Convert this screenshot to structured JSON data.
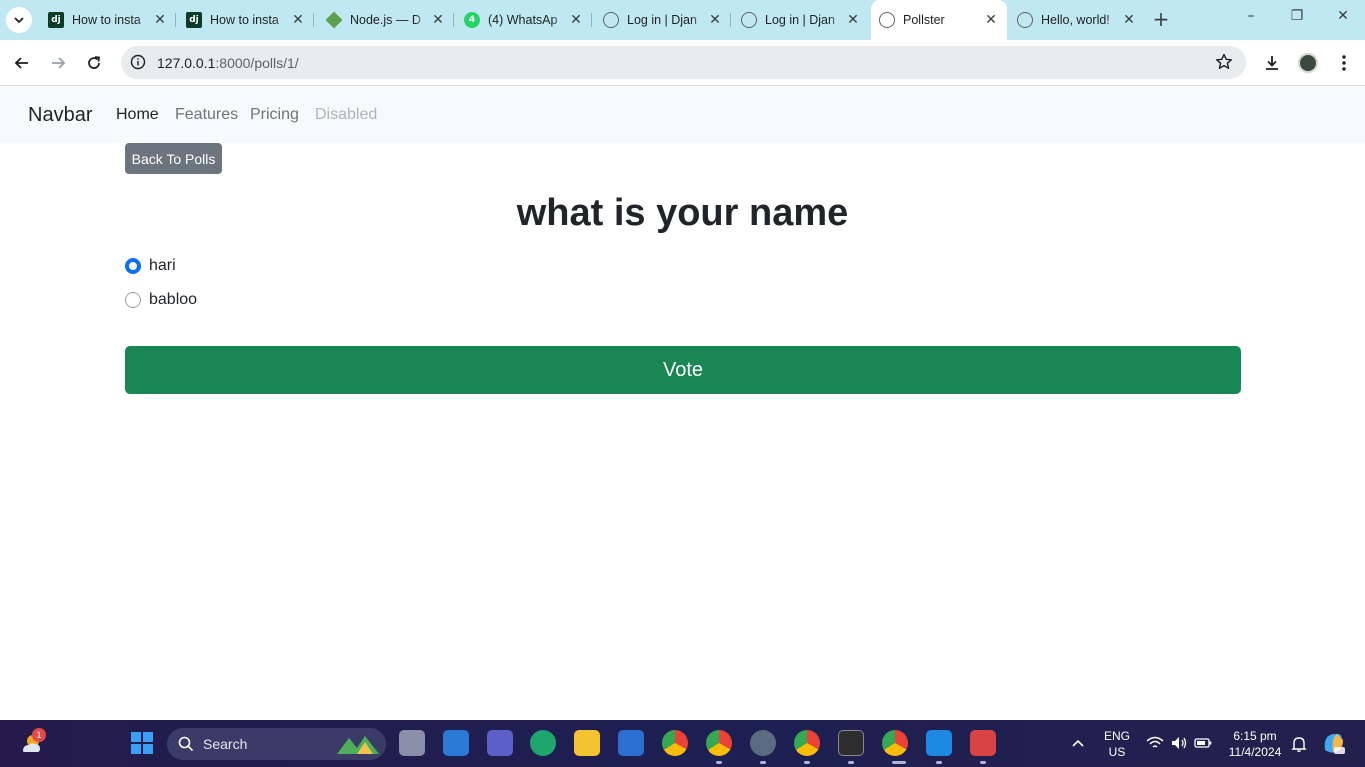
{
  "browser": {
    "tabs": [
      {
        "title": "How to insta",
        "favicon": "dj"
      },
      {
        "title": "How to insta",
        "favicon": "dj"
      },
      {
        "title": "Node.js — D",
        "favicon": "node"
      },
      {
        "title": "(4) WhatsAp",
        "favicon": "whatsapp"
      },
      {
        "title": "Log in | Djan",
        "favicon": "globe"
      },
      {
        "title": "Log in | Djan",
        "favicon": "globe"
      },
      {
        "title": "Pollster",
        "favicon": "globe",
        "active": true
      },
      {
        "title": "Hello, world!",
        "favicon": "globe"
      }
    ],
    "address": "127.0.0.1:8000/polls/1/",
    "address_host": "127.0.0.1",
    "address_rest": ":8000/polls/1/"
  },
  "navbar": {
    "brand": "Navbar",
    "links": [
      {
        "label": "Home",
        "state": "active"
      },
      {
        "label": "Features",
        "state": "normal"
      },
      {
        "label": "Pricing",
        "state": "normal"
      },
      {
        "label": "Disabled",
        "state": "disabled"
      }
    ]
  },
  "poll": {
    "back_label": "Back To Polls",
    "question": "what is your name",
    "choices": [
      {
        "label": "hari",
        "checked": true
      },
      {
        "label": "babloo",
        "checked": false
      }
    ],
    "vote_label": "Vote"
  },
  "taskbar": {
    "weather_badge": "1",
    "search_label": "Search",
    "lang_top": "ENG",
    "lang_bottom": "US",
    "time": "6:15 pm",
    "date": "11/4/2024"
  },
  "colors": {
    "vote": "#198754",
    "back": "#6c757d",
    "radio_checked": "#0d6efd",
    "tabstrip": "#bfe8f3"
  }
}
